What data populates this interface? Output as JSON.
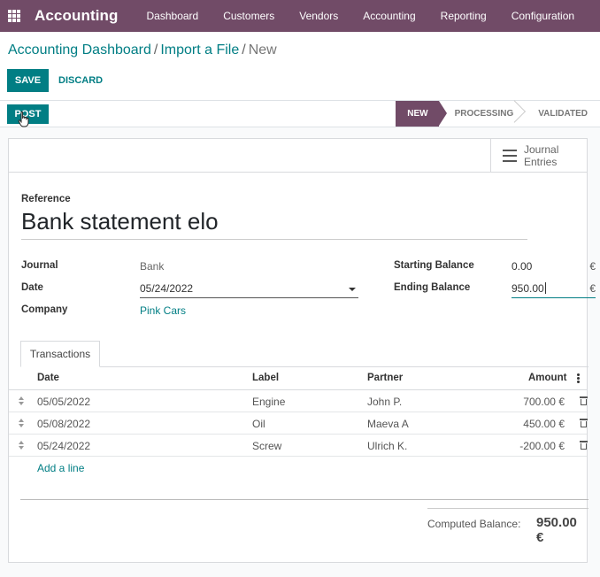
{
  "navbar": {
    "brand": "Accounting",
    "menu": [
      "Dashboard",
      "Customers",
      "Vendors",
      "Accounting",
      "Reporting",
      "Configuration"
    ]
  },
  "breadcrumb": {
    "items": [
      "Accounting Dashboard",
      "Import a File"
    ],
    "current": "New"
  },
  "toolbar": {
    "save_label": "SAVE",
    "discard_label": "DISCARD"
  },
  "statusbar": {
    "post_label": "POST",
    "stages": [
      "NEW",
      "PROCESSING",
      "VALIDATED"
    ],
    "active_stage": "NEW"
  },
  "smart_button": {
    "line1": "Journal",
    "line2": "Entries"
  },
  "form": {
    "reference_label": "Reference",
    "reference_value": "Bank statement elo",
    "journal_label": "Journal",
    "journal_value": "Bank",
    "date_label": "Date",
    "date_value": "05/24/2022",
    "company_label": "Company",
    "company_value": "Pink Cars",
    "starting_balance_label": "Starting Balance",
    "starting_balance_value": "0.00",
    "ending_balance_label": "Ending Balance",
    "ending_balance_value": "950.00",
    "currency": "€"
  },
  "tabs": [
    "Transactions"
  ],
  "table": {
    "columns": [
      "Date",
      "Label",
      "Partner",
      "Amount"
    ],
    "rows": [
      {
        "date": "05/05/2022",
        "label": "Engine",
        "partner": "John P.",
        "amount": "700.00 €"
      },
      {
        "date": "05/08/2022",
        "label": "Oil",
        "partner": "Maeva A",
        "amount": "450.00 €"
      },
      {
        "date": "05/24/2022",
        "label": "Screw",
        "partner": "Ulrich K.",
        "amount": "-200.00 €"
      }
    ],
    "add_line_label": "Add a line"
  },
  "computed_balance": {
    "label": "Computed Balance:",
    "value": "950.00 €"
  },
  "colors": {
    "brand": "#714b67",
    "accent": "#017e84"
  }
}
